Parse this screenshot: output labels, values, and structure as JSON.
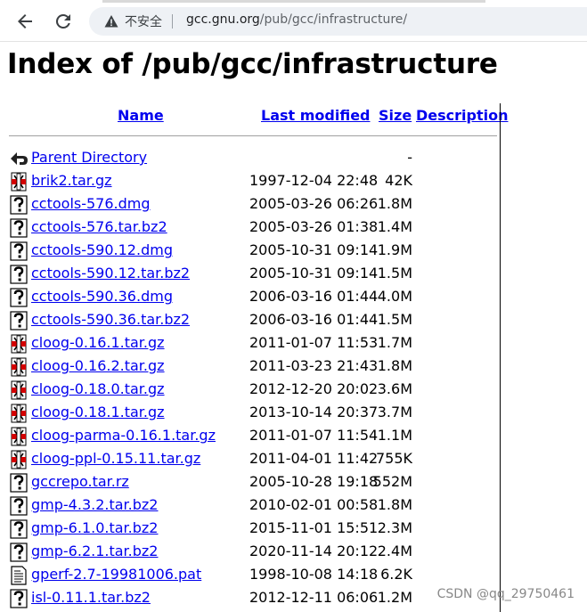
{
  "browser": {
    "security_label": "不安全",
    "url_host": "gcc.gnu.org",
    "url_path": "/pub/gcc/infrastructure/"
  },
  "page": {
    "title": "Index of /pub/gcc/infrastructure",
    "columns": {
      "name": "Name",
      "last_modified": "Last modified",
      "size": "Size",
      "description": "Description"
    },
    "parent": {
      "label": "Parent Directory",
      "size": "-",
      "icon": "back-arrow-icon"
    },
    "files": [
      {
        "name": "brik2.tar.gz",
        "date": "1997-12-04 22:48",
        "size": "42K",
        "icon": "compressed-icon"
      },
      {
        "name": "cctools-576.dmg",
        "date": "2005-03-26 06:26",
        "size": "1.8M",
        "icon": "unknown-icon"
      },
      {
        "name": "cctools-576.tar.bz2",
        "date": "2005-03-26 01:38",
        "size": "1.4M",
        "icon": "unknown-icon"
      },
      {
        "name": "cctools-590.12.dmg",
        "date": "2005-10-31 09:14",
        "size": "1.9M",
        "icon": "unknown-icon"
      },
      {
        "name": "cctools-590.12.tar.bz2",
        "date": "2005-10-31 09:14",
        "size": "1.5M",
        "icon": "unknown-icon"
      },
      {
        "name": "cctools-590.36.dmg",
        "date": "2006-03-16 01:44",
        "size": "4.0M",
        "icon": "unknown-icon"
      },
      {
        "name": "cctools-590.36.tar.bz2",
        "date": "2006-03-16 01:44",
        "size": "1.5M",
        "icon": "unknown-icon"
      },
      {
        "name": "cloog-0.16.1.tar.gz",
        "date": "2011-01-07 11:53",
        "size": "1.7M",
        "icon": "compressed-icon"
      },
      {
        "name": "cloog-0.16.2.tar.gz",
        "date": "2011-03-23 21:43",
        "size": "1.8M",
        "icon": "compressed-icon"
      },
      {
        "name": "cloog-0.18.0.tar.gz",
        "date": "2012-12-20 20:02",
        "size": "3.6M",
        "icon": "compressed-icon"
      },
      {
        "name": "cloog-0.18.1.tar.gz",
        "date": "2013-10-14 20:37",
        "size": "3.7M",
        "icon": "compressed-icon"
      },
      {
        "name": "cloog-parma-0.16.1.tar.gz",
        "date": "2011-01-07 11:54",
        "size": "1.1M",
        "icon": "compressed-icon"
      },
      {
        "name": "cloog-ppl-0.15.11.tar.gz",
        "date": "2011-04-01 11:42",
        "size": "755K",
        "icon": "compressed-icon"
      },
      {
        "name": "gccrepo.tar.rz",
        "date": "2005-10-28 19:18",
        "size": "552M",
        "icon": "unknown-icon"
      },
      {
        "name": "gmp-4.3.2.tar.bz2",
        "date": "2010-02-01 00:58",
        "size": "1.8M",
        "icon": "unknown-icon"
      },
      {
        "name": "gmp-6.1.0.tar.bz2",
        "date": "2015-11-01 15:51",
        "size": "2.3M",
        "icon": "unknown-icon"
      },
      {
        "name": "gmp-6.2.1.tar.bz2",
        "date": "2020-11-14 20:12",
        "size": "2.4M",
        "icon": "unknown-icon"
      },
      {
        "name": "gperf-2.7-19981006.pat",
        "date": "1998-10-08 14:18",
        "size": "6.2K",
        "icon": "text-file-icon"
      },
      {
        "name": "isl-0.11.1.tar.bz2",
        "date": "2012-12-11 06:06",
        "size": "1.2M",
        "icon": "unknown-icon"
      }
    ]
  },
  "watermark": "CSDN @qq_29750461",
  "colors": {
    "link": "#0000ee",
    "omnibox": "#eef1f5"
  }
}
